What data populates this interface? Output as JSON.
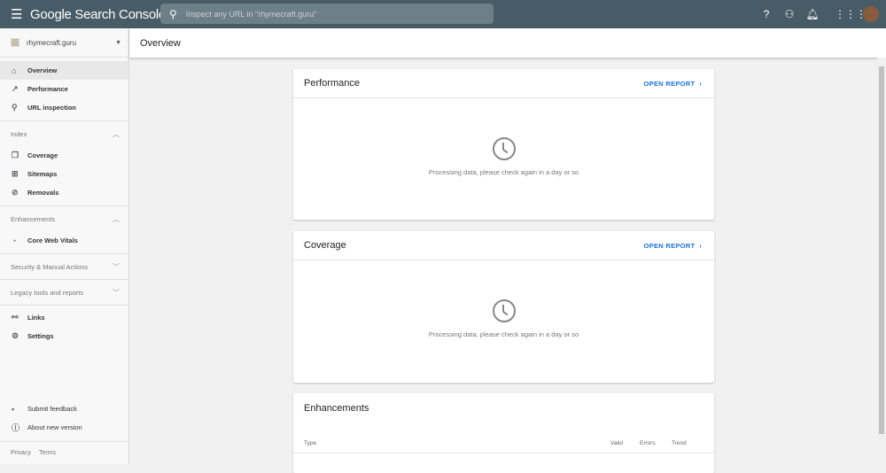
{
  "topbar": {
    "app_title": "Google Search Console",
    "search_placeholder": "Inspect any URL in \"rhymecraft.guru\""
  },
  "property": "rhymecraft.guru",
  "page_title": "Overview",
  "sidebar": {
    "top_items": [
      {
        "label": "Overview",
        "icon": "home-icon"
      },
      {
        "label": "Performance",
        "icon": "trending-up-icon"
      },
      {
        "label": "URL inspection",
        "icon": "search-icon"
      }
    ],
    "index": {
      "label": "Index",
      "items": [
        {
          "label": "Coverage"
        },
        {
          "label": "Sitemaps"
        },
        {
          "label": "Removals"
        }
      ]
    },
    "enhancements": {
      "label": "Enhancements",
      "items": [
        {
          "label": "Core Web Vitals"
        }
      ]
    },
    "security": "Security & Manual Actions",
    "legacy": "Legacy tools and reports",
    "bottom_items": [
      {
        "label": "Links"
      },
      {
        "label": "Settings"
      }
    ],
    "feedback": [
      {
        "label": "Submit feedback"
      },
      {
        "label": "About new version"
      }
    ],
    "footer": {
      "privacy": "Privacy",
      "terms": "Terms"
    }
  },
  "cards": {
    "performance": {
      "title": "Performance",
      "open": "OPEN REPORT",
      "message": "Processing data, please check again in a day or so"
    },
    "coverage": {
      "title": "Coverage",
      "open": "OPEN REPORT",
      "message": "Processing data, please check again in a day or so"
    },
    "enhancements": {
      "title": "Enhancements",
      "columns": [
        "Type",
        "Valid",
        "Errors",
        "Trend"
      ]
    }
  }
}
